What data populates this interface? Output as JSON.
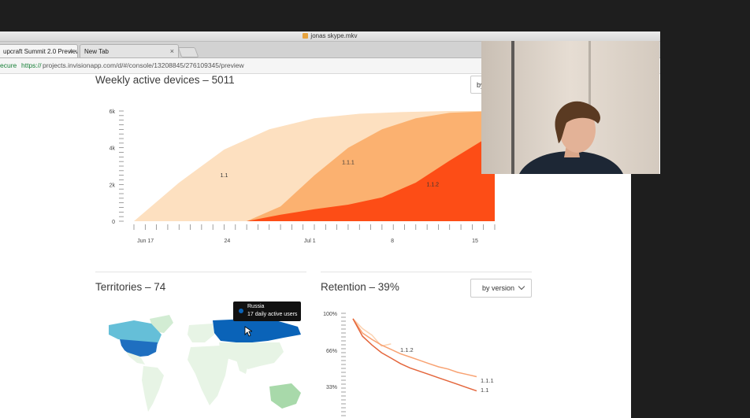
{
  "window": {
    "title": "jonas skype.mkv"
  },
  "tabs": [
    {
      "label": "upcraft Summit 2.0 Preview",
      "close": "×"
    },
    {
      "label": "New Tab",
      "close": "×"
    }
  ],
  "address": {
    "secure": "ecure",
    "protocol": "https://",
    "rest": "projects.invisionapp.com/d/#/console/13208845/276109345/preview"
  },
  "weekly": {
    "title": "Weekly active devices – 5011",
    "dropdown_label": "by",
    "chart_data": {
      "type": "area",
      "title": "Weekly active devices – 5011",
      "y_ticks": [
        "6k",
        "4k",
        "2k",
        "0"
      ],
      "ylim": [
        0,
        6000
      ],
      "x_ticks": [
        "Jun 17",
        "24",
        "Jul 1",
        "8",
        "15"
      ],
      "series": [
        {
          "name": "1.1",
          "color": "#fde0c0",
          "x": [
            0,
            4,
            8,
            12,
            16,
            20,
            24,
            28,
            32
          ],
          "values": [
            0,
            2100,
            3900,
            5000,
            5600,
            5850,
            5950,
            6000,
            6000
          ]
        },
        {
          "name": "1.1.1",
          "color": "#fbb170",
          "x": [
            10,
            13,
            16,
            19,
            22,
            25,
            28,
            32
          ],
          "values": [
            0,
            800,
            2500,
            4000,
            5000,
            5600,
            5900,
            6000
          ]
        },
        {
          "name": "1.1.2",
          "color": "#fd4d16",
          "x": [
            10,
            13,
            16,
            19,
            22,
            25,
            28,
            32
          ],
          "values": [
            0,
            350,
            650,
            900,
            1300,
            2100,
            3300,
            4800
          ]
        }
      ]
    }
  },
  "territories": {
    "title": "Territories – 74",
    "tooltip": {
      "country": "Russia",
      "value": "17 daily active users"
    }
  },
  "retention": {
    "title": "Retention – 39%",
    "dropdown_label": "by version",
    "chart_data": {
      "type": "line",
      "title": "Retention – 39%",
      "y_ticks": [
        "100%",
        "66%",
        "33%"
      ],
      "ylim": [
        0,
        100
      ],
      "series": [
        {
          "name": "1.1.2",
          "color": "#fcd2b0",
          "x": [
            0,
            1,
            2,
            3,
            4
          ],
          "values": [
            95,
            86,
            80,
            70,
            72
          ]
        },
        {
          "name": "1.1.1",
          "color": "#f8a272",
          "x": [
            0,
            1,
            2,
            3,
            4,
            5,
            6,
            7,
            8,
            9,
            10,
            11,
            12,
            13
          ],
          "values": [
            95,
            82,
            76,
            71,
            67,
            63,
            60,
            57,
            54,
            51,
            49,
            46,
            44,
            42
          ]
        },
        {
          "name": "1.1",
          "color": "#e4663c",
          "x": [
            0,
            1,
            2,
            3,
            4,
            5,
            6,
            7,
            8,
            9,
            10,
            11,
            12,
            13
          ],
          "values": [
            95,
            79,
            71,
            64,
            59,
            54,
            50,
            47,
            44,
            41,
            38,
            35,
            32,
            29
          ]
        }
      ]
    }
  }
}
